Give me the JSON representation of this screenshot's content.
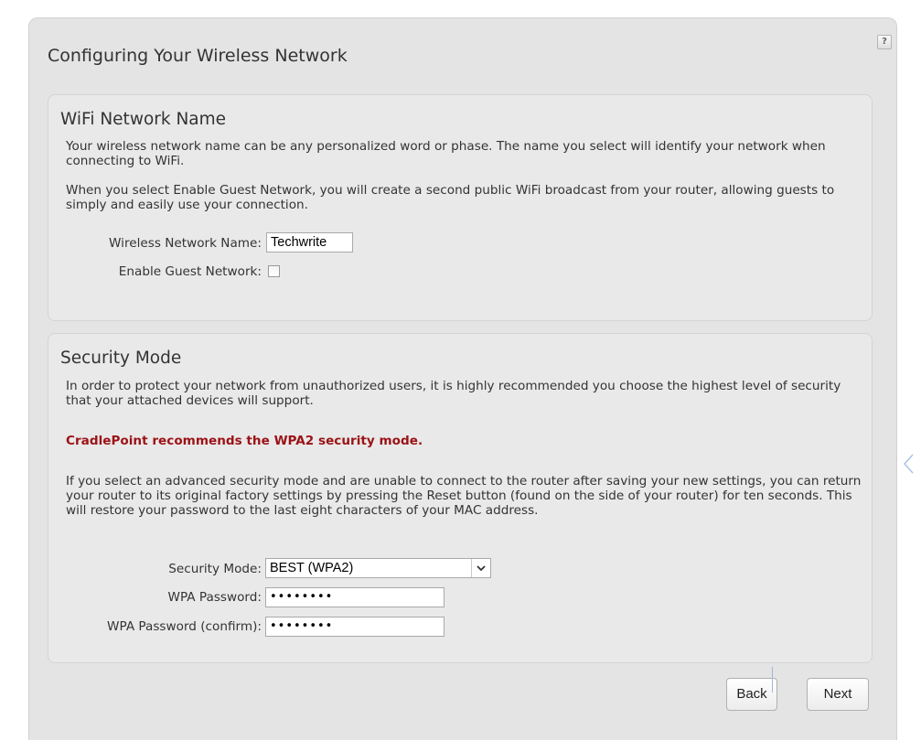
{
  "page": {
    "title": "Configuring Your Wireless Network",
    "help_label": "?"
  },
  "wifi": {
    "title": "WiFi Network Name",
    "para1": "Your wireless network name can be any personalized word or phase. The name you select will identify your network when connecting to WiFi.",
    "para2": "When you select Enable Guest Network, you will create a second public WiFi broadcast from your router, allowing guests to simply and easily use your connection.",
    "name_label": "Wireless Network Name:",
    "name_value": "Techwrite",
    "guest_label": "Enable Guest Network:",
    "guest_checked": false
  },
  "security": {
    "title": "Security Mode",
    "para1": "In order to protect your network from unauthorized users, it is highly recommended you choose the highest level of security that your attached devices will support.",
    "recommendation": "CradlePoint recommends the WPA2 security mode.",
    "para2": "If you select an advanced security mode and are unable to connect to the router after saving your new settings, you can return your router to its original factory settings by pressing the Reset button (found on the side of your router) for ten seconds. This will restore your password to the last eight characters of your MAC address.",
    "mode_label": "Security Mode:",
    "mode_value": "BEST (WPA2)",
    "password_label": "WPA Password:",
    "password_value": "••••••••",
    "confirm_label": "WPA Password (confirm):",
    "confirm_value": "••••••••"
  },
  "actions": {
    "back_label": "Back",
    "next_label": "Next"
  },
  "colors": {
    "panel_bg": "#e4e4e4",
    "section_bg": "#e9e9e9",
    "warning_text": "#9b1216"
  },
  "icons": {
    "help": "help-icon",
    "dropdown": "chevron-down-icon",
    "side_handle": "chevron-left-icon"
  }
}
